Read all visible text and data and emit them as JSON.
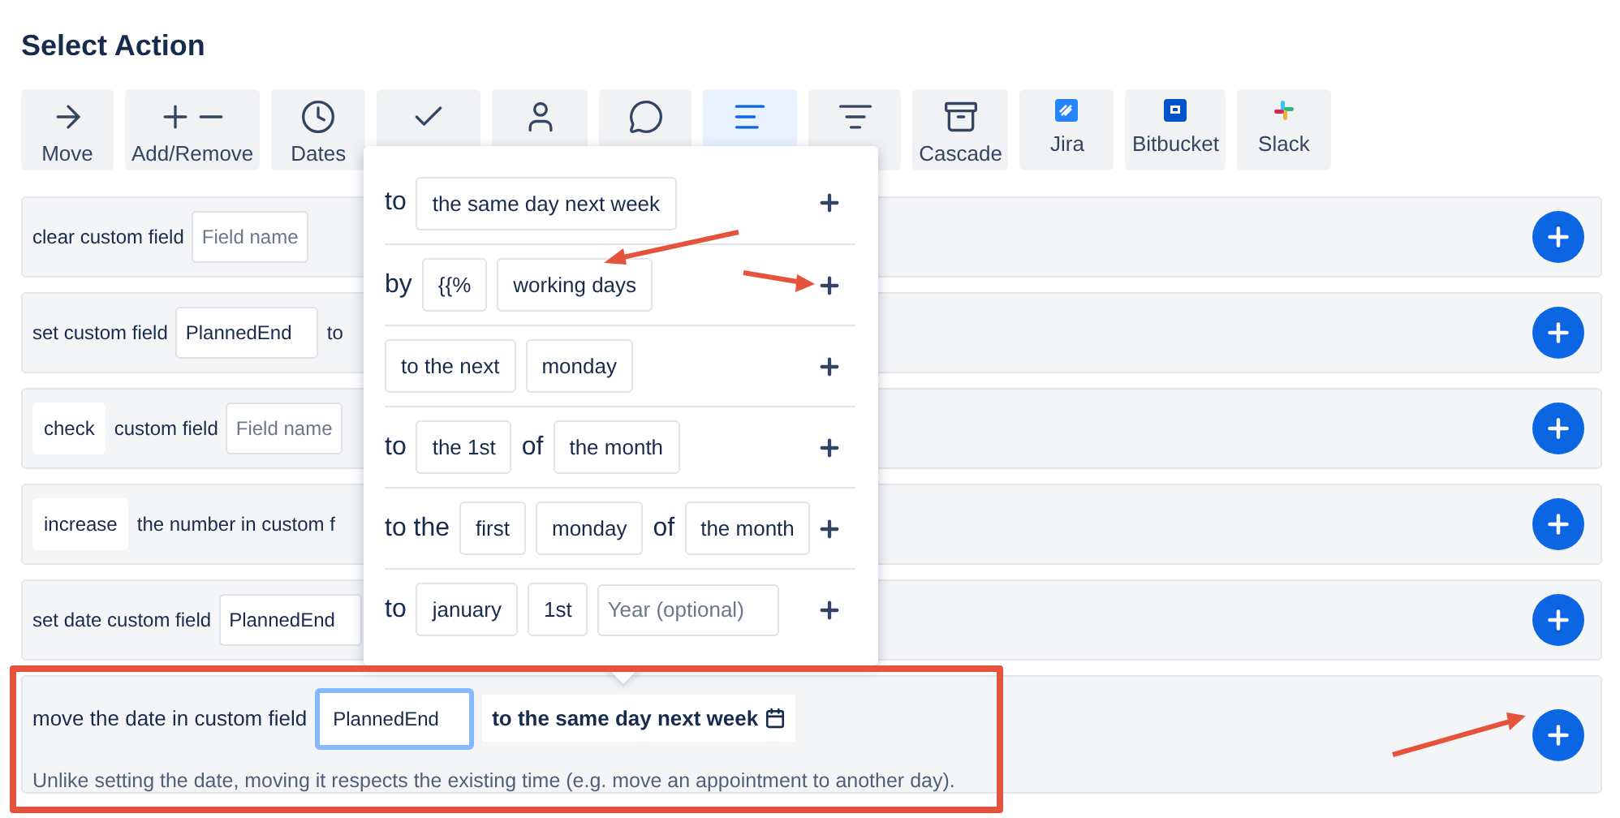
{
  "title": "Select Action",
  "toolbar": [
    {
      "label": "Move",
      "selected": false
    },
    {
      "label": "Add/Remove",
      "selected": false
    },
    {
      "label": "Dates",
      "selected": false
    },
    {
      "selected": false
    },
    {
      "selected": false
    },
    {
      "selected": false
    },
    {
      "selected": true
    },
    {
      "selected": false
    },
    {
      "label": "Cascade",
      "selected": false
    },
    {
      "label": "Jira",
      "selected": false
    },
    {
      "label": "Bitbucket",
      "selected": false
    },
    {
      "label": "Slack",
      "selected": false
    }
  ],
  "rows": [
    {
      "parts": [
        {
          "kind": "text",
          "text": "clear custom field"
        },
        {
          "kind": "input",
          "placeholder": "Field name"
        }
      ]
    },
    {
      "parts": [
        {
          "kind": "text",
          "text": "set custom field"
        },
        {
          "kind": "input",
          "value": "PlannedEnd"
        },
        {
          "kind": "text",
          "text": "to"
        }
      ]
    },
    {
      "parts": [
        {
          "kind": "chip",
          "text": "check"
        },
        {
          "kind": "text",
          "text": "custom field"
        },
        {
          "kind": "input",
          "placeholder": "Field name"
        }
      ]
    },
    {
      "parts": [
        {
          "kind": "chip",
          "text": "increase"
        },
        {
          "kind": "text",
          "text": "the number in custom f"
        }
      ]
    },
    {
      "parts": [
        {
          "kind": "text",
          "text": "set date custom field"
        },
        {
          "kind": "input",
          "value": "PlannedEnd"
        }
      ]
    }
  ],
  "active_row": {
    "parts": [
      {
        "kind": "text",
        "text": "move the date in custom field"
      },
      {
        "kind": "input",
        "value": "PlannedEnd",
        "focused": true
      },
      {
        "kind": "picker",
        "text": "to the same day next week"
      }
    ],
    "description": "Unlike setting the date, moving it respects the existing time (e.g. move an appointment to another day)."
  },
  "popup": {
    "options": [
      {
        "parts": [
          {
            "kind": "text",
            "text": "to"
          },
          {
            "kind": "chip",
            "text": "the same day next week"
          }
        ]
      },
      {
        "parts": [
          {
            "kind": "text",
            "text": "by"
          },
          {
            "kind": "chip",
            "text": "{{%"
          },
          {
            "kind": "chip",
            "text": "working days"
          }
        ]
      },
      {
        "parts": [
          {
            "kind": "chip",
            "text": "to the next"
          },
          {
            "kind": "chip",
            "text": "monday"
          }
        ]
      },
      {
        "parts": [
          {
            "kind": "text",
            "text": "to"
          },
          {
            "kind": "chip",
            "text": "the 1st"
          },
          {
            "kind": "text",
            "text": "of"
          },
          {
            "kind": "chip",
            "text": "the month"
          }
        ]
      },
      {
        "parts": [
          {
            "kind": "text",
            "text": "to the"
          },
          {
            "kind": "chip",
            "text": "first"
          },
          {
            "kind": "chip",
            "text": "monday"
          },
          {
            "kind": "text",
            "text": "of"
          },
          {
            "kind": "chip",
            "text": "the month"
          }
        ]
      },
      {
        "parts": [
          {
            "kind": "text",
            "text": "to"
          },
          {
            "kind": "chip",
            "text": "january"
          },
          {
            "kind": "chip",
            "text": "1st"
          },
          {
            "kind": "input",
            "placeholder": "Year (optional)"
          }
        ]
      }
    ]
  }
}
